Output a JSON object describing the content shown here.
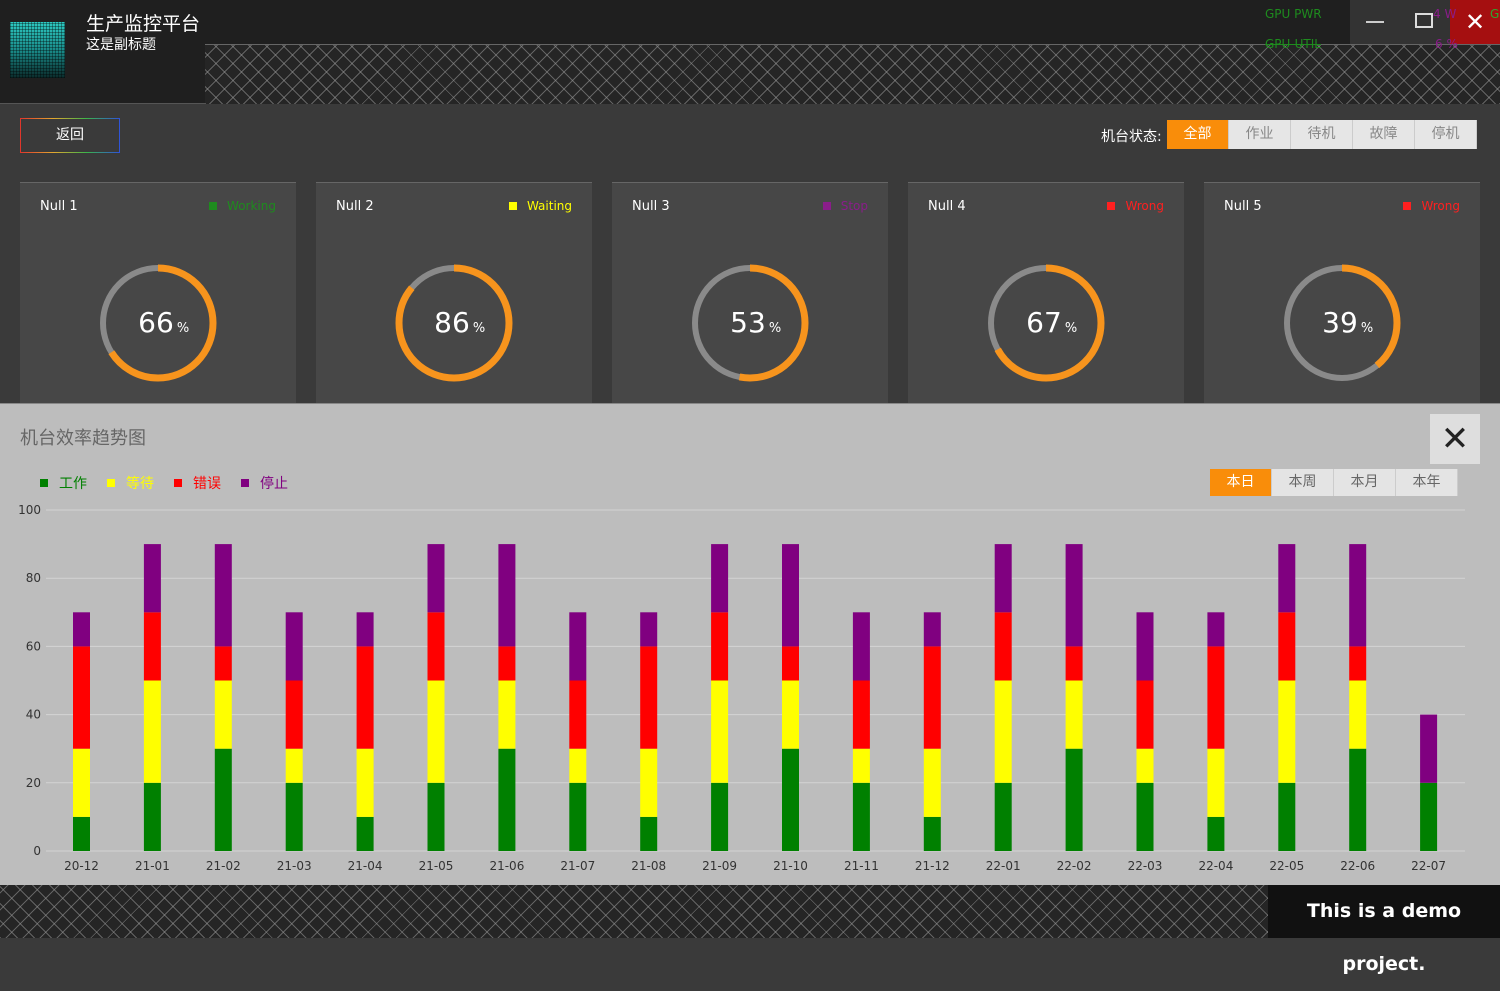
{
  "app": {
    "title": "生产监控平台",
    "subtitle": "这是副标题",
    "gpu_pwr_label": "GPU PWR",
    "gpu_util_label": "GPU-UTIL",
    "gpu_pwr_value": "4 W",
    "gpu_util_value": "6 %",
    "gpu_extra": "G",
    "close_glyph": "✕"
  },
  "toolbar": {
    "back_label": "返回",
    "status_label": "机台状态:",
    "status_filters": [
      "全部",
      "作业",
      "待机",
      "故障",
      "停机"
    ],
    "status_active": 0
  },
  "machines": [
    {
      "name": "Null 1",
      "status": "Working",
      "status_color": "#1e8b1e",
      "percent": 66,
      "unit": "%"
    },
    {
      "name": "Null 2",
      "status": "Waiting",
      "status_color": "#ffff00",
      "percent": 86,
      "unit": "%"
    },
    {
      "name": "Null 3",
      "status": "Stop",
      "status_color": "#8a1d8a",
      "percent": 53,
      "unit": "%"
    },
    {
      "name": "Null 4",
      "status": "Wrong",
      "status_color": "#ff2020",
      "percent": 67,
      "unit": "%"
    },
    {
      "name": "Null 5",
      "status": "Wrong",
      "status_color": "#ff2020",
      "percent": 39,
      "unit": "%"
    }
  ],
  "colors": {
    "accent": "#f98d0a",
    "ring_track": "#8a8a8a",
    "ring_fill": "#f7941d"
  },
  "chart_panel": {
    "title": "机台效率趋势图",
    "close_glyph": "✕",
    "period_filters": [
      "本日",
      "本周",
      "本月",
      "本年"
    ],
    "period_active": 0
  },
  "chart_data": {
    "type": "bar",
    "stacked": true,
    "categories": [
      "20-12",
      "21-01",
      "21-02",
      "21-03",
      "21-04",
      "21-05",
      "21-06",
      "21-07",
      "21-08",
      "21-09",
      "21-10",
      "21-11",
      "21-12",
      "22-01",
      "22-02",
      "22-03",
      "22-04",
      "22-05",
      "22-06",
      "22-07"
    ],
    "series": [
      {
        "name": "工作",
        "color": "#008000",
        "values": [
          10,
          20,
          30,
          20,
          10,
          20,
          30,
          20,
          10,
          20,
          30,
          20,
          10,
          20,
          30,
          20,
          10,
          20,
          30,
          20
        ]
      },
      {
        "name": "等待",
        "color": "#ffff00",
        "values": [
          20,
          30,
          20,
          10,
          20,
          30,
          20,
          10,
          20,
          30,
          20,
          10,
          20,
          30,
          20,
          10,
          20,
          30,
          20,
          0
        ]
      },
      {
        "name": "错误",
        "color": "#ff0000",
        "values": [
          30,
          20,
          10,
          20,
          30,
          20,
          10,
          20,
          30,
          20,
          10,
          20,
          30,
          20,
          10,
          20,
          30,
          20,
          10,
          0
        ]
      },
      {
        "name": "停止",
        "color": "#800080",
        "values": [
          10,
          20,
          30,
          20,
          10,
          20,
          30,
          20,
          10,
          20,
          30,
          20,
          10,
          20,
          30,
          20,
          10,
          20,
          30,
          20
        ]
      }
    ],
    "yticks": [
      0,
      20,
      40,
      60,
      80,
      100
    ],
    "ylim": [
      0,
      100
    ],
    "grid": true,
    "legend": "top-left"
  },
  "footer": {
    "text": "This is a demo project."
  }
}
